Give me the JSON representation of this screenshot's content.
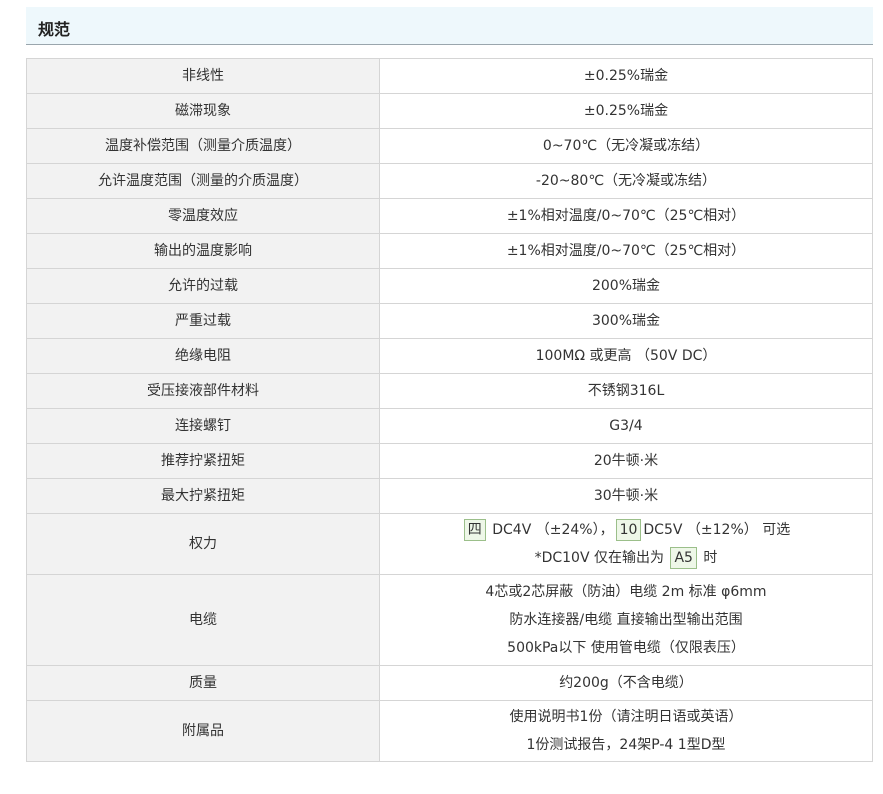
{
  "header": {
    "title": "规范"
  },
  "rows": [
    {
      "label": "非线性",
      "value": "±0.25%瑞金"
    },
    {
      "label": "磁滞现象",
      "value": "±0.25%瑞金"
    },
    {
      "label": "温度补偿范围（测量介质温度）",
      "value": "0~70℃（无冷凝或冻结）"
    },
    {
      "label": "允许温度范围（测量的介质温度）",
      "value": "-20~80℃（无冷凝或冻结）"
    },
    {
      "label": "零温度效应",
      "value": "±1%相对温度/0~70℃（25℃相对）"
    },
    {
      "label": "输出的温度影响",
      "value": "±1%相对温度/0~70℃（25℃相对）"
    },
    {
      "label": "允许的过载",
      "value": "200%瑞金"
    },
    {
      "label": "严重过载",
      "value": "300%瑞金"
    },
    {
      "label": "绝缘电阻",
      "value": "100MΩ 或更高 （50V DC）"
    },
    {
      "label": "受压接液部件材料",
      "value": "不锈钢316L"
    },
    {
      "label": "连接螺钉",
      "value": "G3/4"
    },
    {
      "label": "推荐拧紧扭矩",
      "value": "20牛顿·米"
    },
    {
      "label": "最大拧紧扭矩",
      "value": "30牛顿·米"
    }
  ],
  "power": {
    "label": "权力",
    "tag1": "四",
    "text1": " DC4V （±24%），",
    "tag2": "10",
    "text2": "DC5V （±12%） 可选",
    "text3": "*DC10V 仅在输出为 ",
    "tag3": "A5",
    "text4": " 时"
  },
  "cable": {
    "label": "电缆",
    "line1": "4芯或2芯屏蔽（防油）电缆 2m 标准 φ6mm",
    "line2": "防水连接器/电缆 直接输出型输出范围",
    "line3": "500kPa以下 使用管电缆（仅限表压）"
  },
  "mass": {
    "label": "质量",
    "value": "约200g（不含电缆）"
  },
  "accessories": {
    "label": "附属品",
    "line1": "使用说明书1份（请注明日语或英语）",
    "line2": "1份测试报告，24架P-4 1型D型"
  }
}
